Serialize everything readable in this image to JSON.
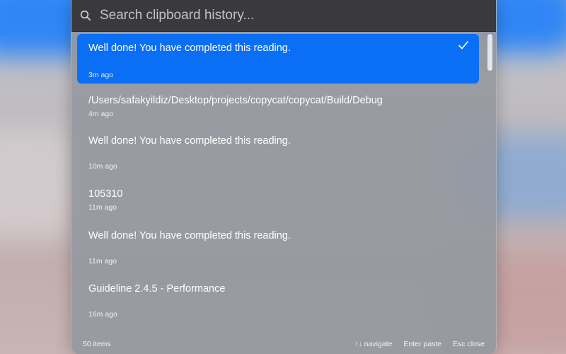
{
  "search": {
    "placeholder": "Search clipboard history..."
  },
  "items": [
    {
      "text": "Well done! You have completed this reading.",
      "time": "3m ago",
      "selected": true
    },
    {
      "text": "/Users/safakyildiz/Desktop/projects/copycat/copycat/Build/Debug",
      "time": "4m ago",
      "selected": false
    },
    {
      "text": "Well done! You have completed this reading.",
      "time": "10m ago",
      "selected": false
    },
    {
      "text": "105310",
      "time": "11m ago",
      "selected": false
    },
    {
      "text": "Well done! You have completed this reading.",
      "time": "11m ago",
      "selected": false
    },
    {
      "text": "Guideline 2.4.5 - Performance",
      "time": "16m ago",
      "selected": false
    }
  ],
  "footer": {
    "count": "50 items",
    "navigate_hint": "↑↓ navigate",
    "paste_hint": "Enter paste",
    "close_hint": "Esc close"
  },
  "colors": {
    "accent": "#0b6ff5",
    "search_bar": "#3a3a3c"
  },
  "icons": {
    "search": "search-icon",
    "selected_mark": "check-icon"
  }
}
